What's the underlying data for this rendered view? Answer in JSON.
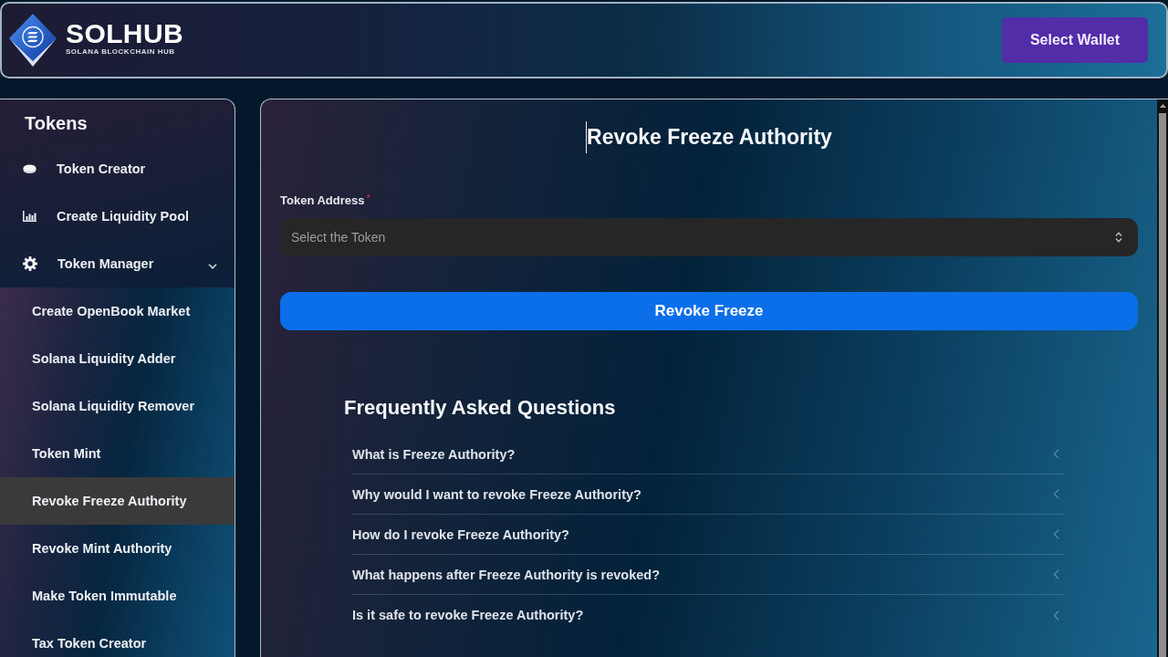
{
  "header": {
    "logo": {
      "name": "SOLHUB",
      "tagline": "SOLANA BLOCKCHAIN HUB"
    },
    "wallet_button": "Select Wallet"
  },
  "sidebar": {
    "title": "Tokens",
    "items": [
      {
        "label": "Token Creator",
        "selected": false
      },
      {
        "label": "Create Liquidity Pool",
        "selected": false
      },
      {
        "label": "Token Manager",
        "selected": false,
        "expanded": true,
        "children": [
          {
            "label": "Create OpenBook Market",
            "selected": false
          },
          {
            "label": "Solana Liquidity Adder",
            "selected": false
          },
          {
            "label": "Solana Liquidity Remover",
            "selected": false
          },
          {
            "label": "Token Mint",
            "selected": false
          },
          {
            "label": "Revoke Freeze Authority",
            "selected": true
          },
          {
            "label": "Revoke Mint Authority",
            "selected": false
          },
          {
            "label": "Make Token Immutable",
            "selected": false
          },
          {
            "label": "Tax Token Creator",
            "selected": false
          }
        ]
      }
    ]
  },
  "main": {
    "title": "Revoke Freeze Authority",
    "form": {
      "label": "Token Address",
      "required_mark": "*",
      "select": {
        "placeholder": "Select the Token"
      },
      "submit_button": "Revoke Freeze"
    },
    "faq": {
      "title": "Frequently Asked Questions",
      "items": [
        {
          "question": "What is Freeze Authority?",
          "expanded": false
        },
        {
          "question": "Why would I want to revoke Freeze Authority?",
          "expanded": false
        },
        {
          "question": "How do I revoke Freeze Authority?",
          "expanded": false
        },
        {
          "question": "What happens after Freeze Authority is revoked?",
          "expanded": false
        },
        {
          "question": "Is it safe to revoke Freeze Authority?",
          "expanded": false
        }
      ]
    }
  }
}
